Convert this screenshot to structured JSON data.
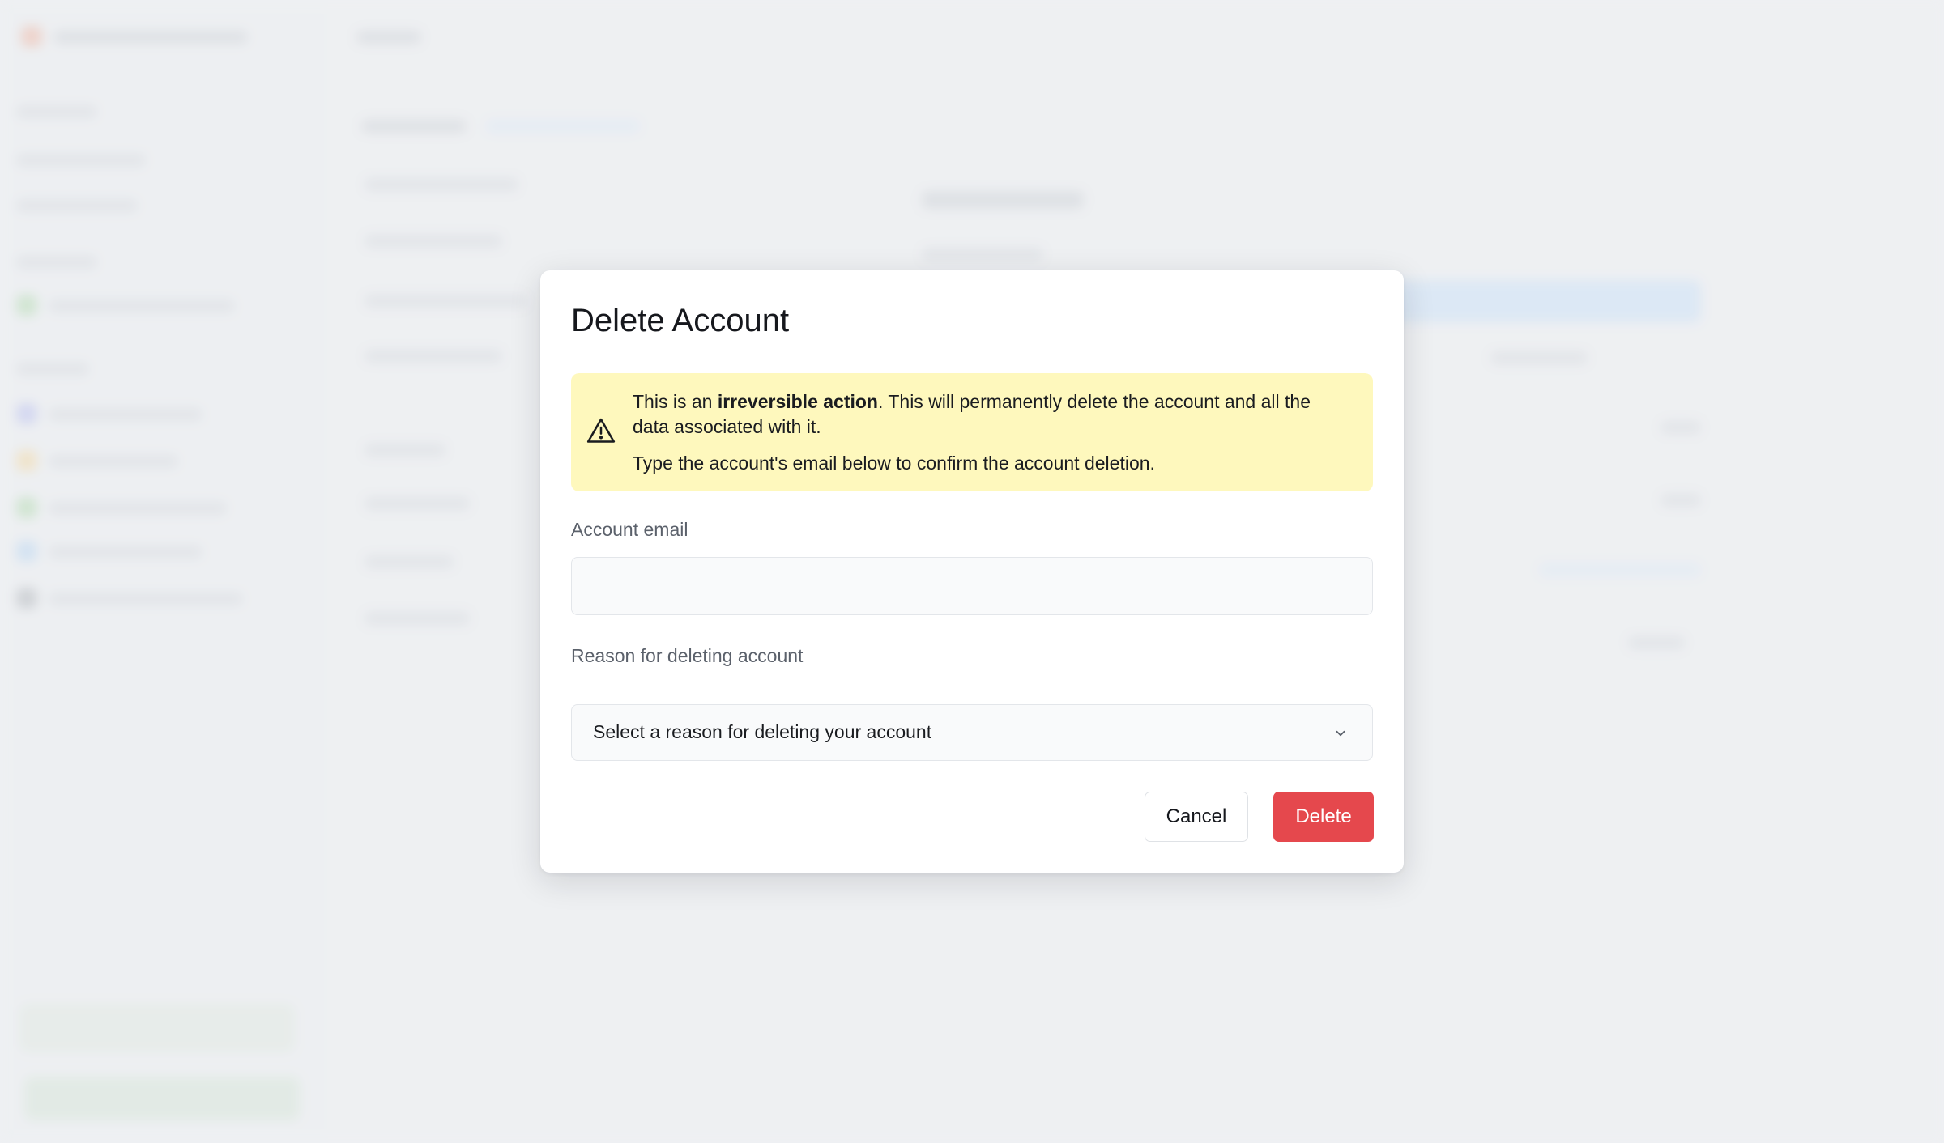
{
  "dialog": {
    "title": "Delete Account",
    "warning": {
      "prefix": "This is an ",
      "emphasis": "irreversible action",
      "suffix": ". This will permanently delete the account and all the data associated with it.",
      "instruction": "Type the account's email below to confirm the account deletion."
    },
    "email_field": {
      "label": "Account email",
      "value": "",
      "placeholder": ""
    },
    "reason_field": {
      "label": "Reason for deleting account",
      "selected": "Select a reason for deleting your account"
    },
    "cancel_label": "Cancel",
    "delete_label": "Delete"
  },
  "colors": {
    "warning_bg": "#fef8bd",
    "danger": "#e5484d",
    "backdrop": "#f0f1f3"
  },
  "icons": {
    "warning": "warning-triangle-icon",
    "chevron": "chevron-down-icon"
  }
}
